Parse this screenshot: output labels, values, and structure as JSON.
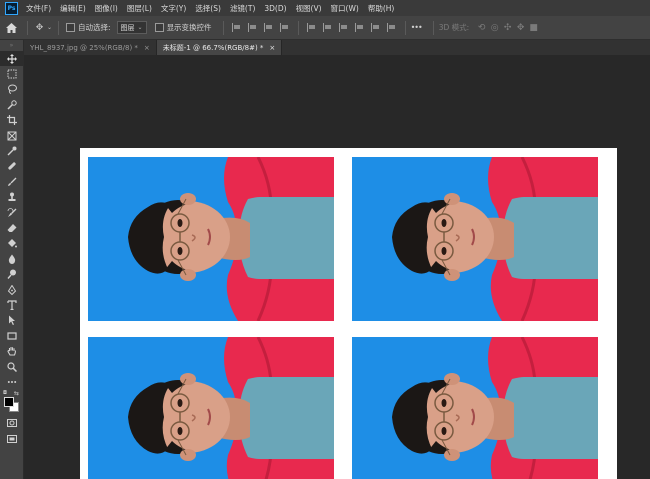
{
  "app": {
    "logo_text": "Ps",
    "menu": [
      "文件(F)",
      "编辑(E)",
      "图像(I)",
      "图层(L)",
      "文字(Y)",
      "选择(S)",
      "滤镜(T)",
      "3D(D)",
      "视图(V)",
      "窗口(W)",
      "帮助(H)"
    ]
  },
  "options_bar": {
    "auto_select_label": "自动选择:",
    "auto_select_target": "图层",
    "show_transform_label": "显示变换控件",
    "more_label": "•••",
    "mode_3d_label": "3D 模式:"
  },
  "tabs": [
    {
      "label": "YHL_8937.jpg @ 25%(RGB/8) *",
      "active": false
    },
    {
      "label": "未标题-1 @ 66.7%(RGB/8#) *",
      "active": true
    }
  ],
  "tab_close_glyph": "×",
  "colors": {
    "foreground": "#000000",
    "background": "#ffffff",
    "photo_backdrop": "#1e8ee6",
    "jacket": "#e8294e",
    "shirt": "#6aa6b8"
  },
  "toolbar": {
    "tools": [
      "move-tool",
      "marquee-tool",
      "lasso-tool",
      "quick-select-tool",
      "crop-tool",
      "frame-tool",
      "eyedropper-tool",
      "healing-brush-tool",
      "brush-tool",
      "clone-stamp-tool",
      "history-brush-tool",
      "eraser-tool",
      "gradient-tool",
      "blur-tool",
      "dodge-tool",
      "pen-tool",
      "type-tool",
      "path-select-tool",
      "rectangle-tool",
      "hand-tool",
      "zoom-tool",
      "more-tools"
    ]
  },
  "canvas": {
    "photos": [
      "id-photo",
      "id-photo",
      "id-photo",
      "id-photo"
    ]
  }
}
